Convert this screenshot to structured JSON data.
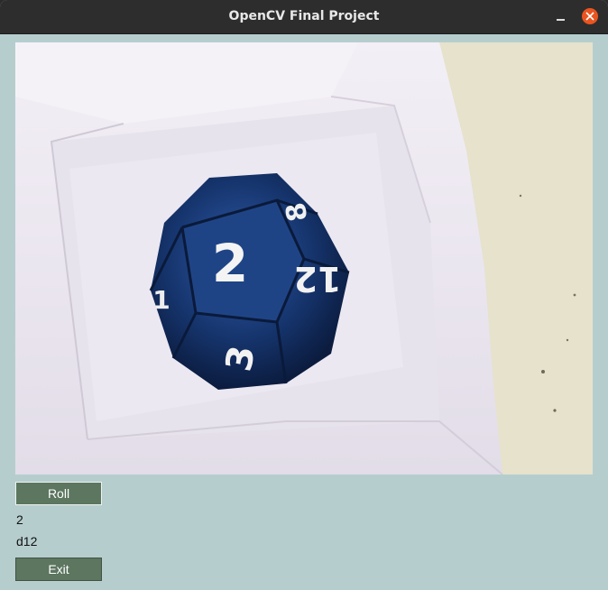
{
  "window": {
    "title": "OpenCV Final Project",
    "close_color": "#e95420"
  },
  "camera_frame": {
    "description_icon": "camera-feed",
    "die_faces": [
      "2",
      "12",
      "3",
      "8",
      "1"
    ]
  },
  "controls": {
    "roll_label": "Roll",
    "result_value": "2",
    "die_type": "d12",
    "exit_label": "Exit"
  },
  "colors": {
    "background": "#b6cdce",
    "button": "#5c7660",
    "die": "#16356e"
  }
}
